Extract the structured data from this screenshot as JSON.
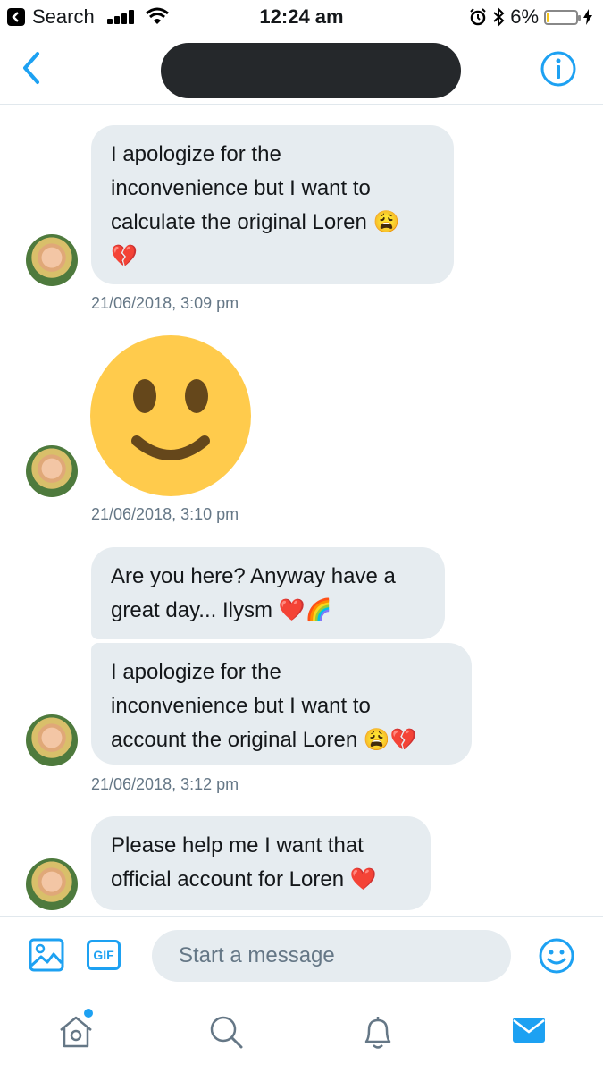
{
  "status_bar": {
    "back_app_label": "Search",
    "time": "12:24 am",
    "battery_percent": "6%",
    "battery_level": 0.06
  },
  "header": {
    "back_icon": "chevron-left-icon",
    "title_redacted": true,
    "info_icon": "info-icon"
  },
  "messages": [
    {
      "lines": [
        "I apologize for the",
        "inconvenience but I want to",
        "calculate the original Loren 😩",
        "💔"
      ],
      "timestamp": "21/06/2018, 3:09 pm"
    },
    {
      "emoji_only": "slightly-smiling-face",
      "timestamp": "21/06/2018, 3:10 pm"
    },
    {
      "lines": [
        "Are you here? Anyway have a",
        "great day... Ilysm ❤️🌈"
      ]
    },
    {
      "lines": [
        "I apologize for the",
        "inconvenience but I want to",
        "account the original Loren 😩💔"
      ],
      "timestamp": "21/06/2018, 3:12 pm"
    },
    {
      "lines": [
        "Please help me I want that",
        "official account for Loren ❤️"
      ]
    }
  ],
  "composer": {
    "placeholder": "Start a message",
    "gif_label": "GIF",
    "icons": [
      "image-icon",
      "gif-icon",
      "smiley-icon"
    ]
  },
  "tab_bar": {
    "tabs": [
      "home-icon",
      "search-icon",
      "notifications-bell-icon",
      "messages-envelope-icon"
    ],
    "active": "messages-envelope-icon"
  },
  "colors": {
    "accent": "#1da1f2",
    "bubble": "#e6ecf0",
    "timestamp": "#657786"
  }
}
